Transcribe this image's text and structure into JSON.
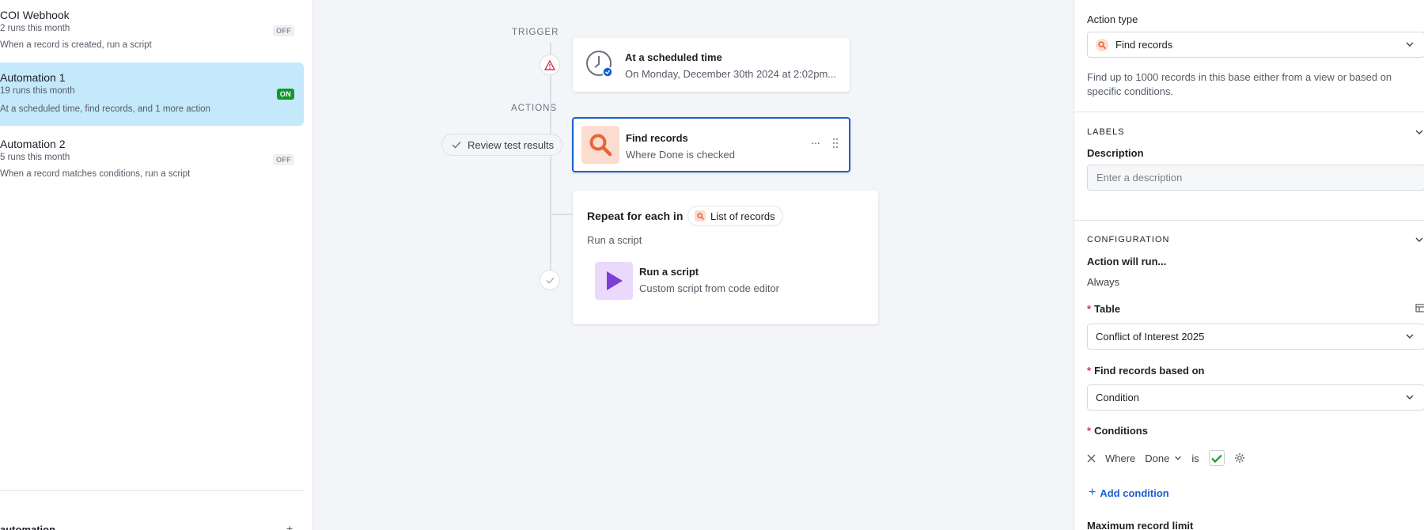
{
  "automations": [
    {
      "title": "COI Webhook",
      "runs": "2 runs this month",
      "desc": "When a record is created, run a script",
      "status": "OFF"
    },
    {
      "title": "Automation 1",
      "runs": "19 runs this month",
      "desc": "At a scheduled time, find records, and 1 more action",
      "status": "ON"
    },
    {
      "title": "Automation 2",
      "runs": "5 runs this month",
      "desc": "When a record matches conditions, run a script",
      "status": "OFF"
    }
  ],
  "left_bottom": {
    "label": "automation"
  },
  "canvas": {
    "trigger_label": "TRIGGER",
    "actions_label": "ACTIONS",
    "trigger_card": {
      "title": "At a scheduled time",
      "sub": "On Monday, December 30th 2024 at 2:02pm..."
    },
    "review_pill": "Review test results",
    "find_card": {
      "title": "Find records",
      "sub": "Where Done is checked"
    },
    "repeat_card": {
      "title": "Repeat for each in",
      "list_token": "List of records",
      "sub": "Run a script"
    },
    "script_card": {
      "title": "Run a script",
      "sub": "Custom script from code editor"
    }
  },
  "right": {
    "action_type_label": "Action type",
    "action_type_value": "Find records",
    "action_desc": "Find up to 1000 records in this base either from a view or based on specific conditions.",
    "labels_section": "LABELS",
    "description_label": "Description",
    "description_placeholder": "Enter a description",
    "config_section": "CONFIGURATION",
    "action_will_run_label": "Action will run...",
    "action_will_run_value": "Always",
    "table_label": "Table",
    "table_value": "Conflict of Interest 2025",
    "based_on_label": "Find records based on",
    "based_on_value": "Condition",
    "conditions_label": "Conditions",
    "cond_where": "Where",
    "cond_field": "Done",
    "cond_op": "is",
    "add_condition": "Add condition",
    "max_limit_label": "Maximum record limit"
  },
  "colors": {
    "accent": "#1a5fd0",
    "on_green": "#119a2a",
    "selected_bg": "#c4e9fb",
    "find_orange": "#e8643a",
    "script_purple": "#7b3fd6"
  }
}
